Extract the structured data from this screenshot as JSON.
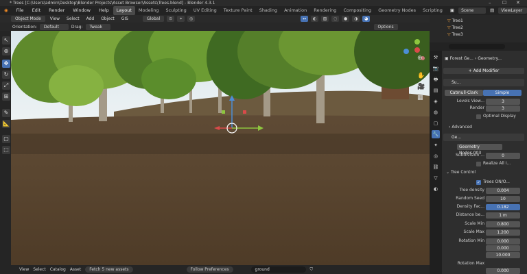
{
  "window": {
    "title": "* Trees [C:\\Users\\admin\\Desktop\\Blender Projects\\Asset Browser\\Assets\\Trees.blend] - Blender 4.3.1"
  },
  "menu": {
    "items": [
      "File",
      "Edit",
      "Render",
      "Window",
      "Help"
    ],
    "workspaces": [
      "Layout",
      "Modeling",
      "Sculpting",
      "UV Editing",
      "Texture Paint",
      "Shading",
      "Animation",
      "Rendering",
      "Compositing",
      "Geometry Nodes",
      "Scripting"
    ],
    "active_workspace": "Layout",
    "scene": "Scene",
    "view_layer": "ViewLayer"
  },
  "viewport_header": {
    "mode": "Object Mode",
    "menus": [
      "View",
      "Select",
      "Add",
      "Object",
      "GIS"
    ],
    "orientation": "Global"
  },
  "tool_settings": {
    "orientation_label": "Orientation:",
    "orientation_value": "Default",
    "drag_label": "Drag:",
    "drag_value": "Tweak",
    "options": "Options"
  },
  "viewport": {
    "sky_color": "#e4ecef",
    "ground_color": "#5a4630"
  },
  "bottom_bar": {
    "menus": [
      "View",
      "Select",
      "Catalog",
      "Asset"
    ],
    "fetch": "Fetch 5 new assets",
    "follow": "Follow Preferences",
    "search_value": "ground"
  },
  "outliner": {
    "items": [
      "Tree1",
      "Tree2",
      "Tree3"
    ],
    "search_placeholder": ""
  },
  "properties": {
    "object_name": "Forest Ge...",
    "modifier_tab": "Geometry...",
    "add_modifier": "Add Modifier",
    "subsurf": {
      "name": "Su...",
      "catmull": "Catmull-Clark",
      "simple": "Simple",
      "levels_label": "Levels View...",
      "levels_value": "3",
      "render_label": "Render",
      "render_value": "3",
      "optimal": "Optimal Display",
      "advanced": "Advanced"
    },
    "geonodes": {
      "name": "Ge...",
      "group": "Geometry Nodes.003",
      "subdivision_label": "Subdivision ...",
      "subdivision_value": "0",
      "realize_label": "Realize All I..."
    },
    "tree_control": {
      "header": "Tree Control",
      "trees_toggle": "Trees ON/O...",
      "density_label": "Tree density",
      "density_value": "0.004",
      "seed_label": "Random Seed",
      "seed_value": "10",
      "density_fac_label": "Density Fac...",
      "density_fac_value": "0.182",
      "distance_label": "Distance be...",
      "distance_value": "1 m",
      "scale_min_label": "Scale Min",
      "scale_min_value": "0.800",
      "scale_max_label": "Scale Max",
      "scale_max_value": "1.200",
      "rot_min_label": "Rotation Min",
      "rot_min_values": [
        "0.000",
        "0.000",
        "10.000"
      ],
      "rot_max_label": "Rotation Max",
      "rot_max_value": "0.000"
    }
  }
}
